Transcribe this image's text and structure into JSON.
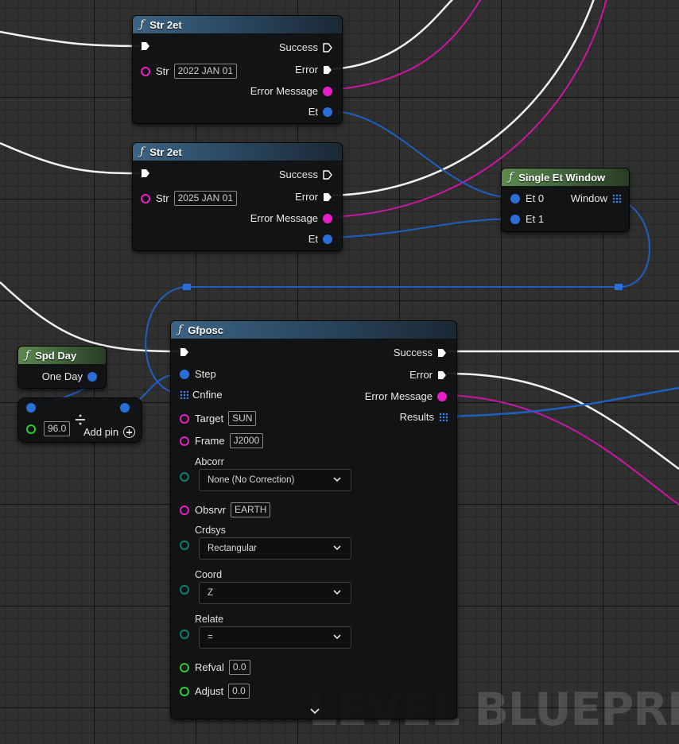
{
  "watermark": "LEVEL BLUEPRINT",
  "icons": {
    "function": "function-icon",
    "exec_pin": "exec-pin-icon",
    "array_pin": "array-pin-icon",
    "dropdown": "chevron-down-icon",
    "add_pin": "plus-circle-icon",
    "divide": "divide-icon",
    "expand": "chevron-down-icon"
  },
  "colors": {
    "exec_wire": "#ffffff",
    "string_pin": "#e61fc8",
    "struct_pin": "#2a6fd8",
    "float_pin": "#2ecc2e",
    "enum_pin": "#0b7f72",
    "function_header": "#3c6384",
    "pure_header": "#5d8a4f"
  },
  "nodes": {
    "str2et_1": {
      "title": "Str 2et",
      "str_label": "Str",
      "str_value": "2022 JAN 01",
      "success": "Success",
      "error": "Error",
      "error_message": "Error Message",
      "et": "Et"
    },
    "str2et_2": {
      "title": "Str 2et",
      "str_label": "Str",
      "str_value": "2025 JAN 01",
      "success": "Success",
      "error": "Error",
      "error_message": "Error Message",
      "et": "Et"
    },
    "single_et_window": {
      "title": "Single Et Window",
      "et0": "Et 0",
      "et1": "Et 1",
      "window": "Window"
    },
    "spd_day": {
      "title": "Spd Day",
      "one_day": "One Day"
    },
    "divide": {
      "value": "96.0",
      "add_pin": "Add pin"
    },
    "gfposc": {
      "title": "Gfposc",
      "step": "Step",
      "cnfine": "Cnfine",
      "target_label": "Target",
      "target_value": "SUN",
      "frame_label": "Frame",
      "frame_value": "J2000",
      "abcorr_label": "Abcorr",
      "abcorr_value": "None (No Correction)",
      "obsrvr_label": "Obsrvr",
      "obsrvr_value": "EARTH",
      "crdsys_label": "Crdsys",
      "crdsys_value": "Rectangular",
      "coord_label": "Coord",
      "coord_value": "Z",
      "relate_label": "Relate",
      "relate_value": "=",
      "refval_label": "Refval",
      "refval_value": "0.0",
      "adjust_label": "Adjust",
      "adjust_value": "0.0",
      "success": "Success",
      "error": "Error",
      "error_message": "Error Message",
      "results": "Results"
    }
  }
}
